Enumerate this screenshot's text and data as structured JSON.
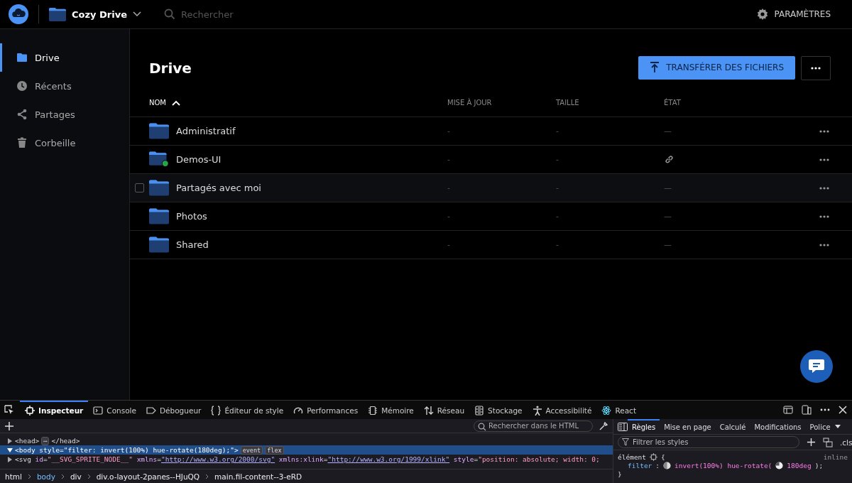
{
  "app_bar": {
    "app_name": "Cozy Drive",
    "search": {
      "placeholder": "Rechercher"
    },
    "settings": "PARAMÈTRES"
  },
  "sidebar": {
    "items": [
      {
        "label": "Drive",
        "selected": true
      },
      {
        "label": "Récents",
        "selected": false
      },
      {
        "label": "Partages",
        "selected": false
      },
      {
        "label": "Corbeille",
        "selected": false
      }
    ]
  },
  "main": {
    "title": "Drive",
    "upload_button": "TRANSFÉRER DES FICHIERS",
    "table": {
      "columns": [
        {
          "label": "NOM",
          "sorted": true
        },
        {
          "label": "MISE À JOUR",
          "sorted": false
        },
        {
          "label": "TAILLE",
          "sorted": false
        },
        {
          "label": "ÉTAT",
          "sorted": false
        }
      ],
      "rows": [
        {
          "name": "Administratif",
          "updated": "-",
          "size": "-",
          "state": {
            "kind": "none",
            "text": "—"
          },
          "shared": false,
          "hovered": false
        },
        {
          "name": "Demos-UI",
          "updated": "-",
          "size": "-",
          "state": {
            "kind": "link"
          },
          "shared": true,
          "hovered": false
        },
        {
          "name": "Partagés avec moi",
          "updated": "-",
          "size": "-",
          "state": {
            "kind": "none",
            "text": "—"
          },
          "shared": false,
          "hovered": true
        },
        {
          "name": "Photos",
          "updated": "-",
          "size": "-",
          "state": {
            "kind": "none",
            "text": "—"
          },
          "shared": false,
          "hovered": false
        },
        {
          "name": "Shared",
          "updated": "-",
          "size": "-",
          "state": {
            "kind": "none",
            "text": "—"
          },
          "shared": false,
          "hovered": false
        }
      ]
    }
  },
  "devtools": {
    "tabs": [
      {
        "label": "Inspecteur",
        "selected": true
      },
      {
        "label": "Console",
        "selected": false
      },
      {
        "label": "Débogueur",
        "selected": false
      },
      {
        "label": "Éditeur de style",
        "selected": false
      },
      {
        "label": "Performances",
        "selected": false
      },
      {
        "label": "Mémoire",
        "selected": false
      },
      {
        "label": "Réseau",
        "selected": false
      },
      {
        "label": "Stockage",
        "selected": false
      },
      {
        "label": "Accessibilité",
        "selected": false
      },
      {
        "label": "React",
        "selected": false
      }
    ],
    "html_search": {
      "placeholder": "Rechercher dans le HTML"
    },
    "markup": [
      {
        "expanded": false,
        "selected": false,
        "tokens": [
          {
            "kind": "tag",
            "text": "<head>"
          },
          {
            "kind": "badge",
            "text": "⋯"
          },
          {
            "kind": "tag",
            "text": "</head>"
          }
        ]
      },
      {
        "expanded": true,
        "selected": true,
        "tokens": [
          {
            "kind": "tag",
            "text": "<body "
          },
          {
            "kind": "attr",
            "text": "style"
          },
          {
            "kind": "tag",
            "text": "="
          },
          {
            "kind": "value",
            "text": "\"filter: invert(100%) hue-rotate(180deg);\""
          },
          {
            "kind": "tag",
            "text": ">"
          },
          {
            "kind": "badge",
            "text": "event"
          },
          {
            "kind": "badge",
            "text": "flex"
          }
        ]
      },
      {
        "expanded": false,
        "selected": false,
        "tokens": [
          {
            "kind": "tag",
            "text": "<svg "
          },
          {
            "kind": "attr",
            "text": "id"
          },
          {
            "kind": "tag",
            "text": "="
          },
          {
            "kind": "value",
            "text": "\"__SVG_SPRITE_NODE__\" "
          },
          {
            "kind": "attr",
            "text": "xmlns"
          },
          {
            "kind": "tag",
            "text": "="
          },
          {
            "kind": "link",
            "text": "\"http://www.w3.org/2000/svg\""
          },
          {
            "kind": "attr",
            "text": " xmlns:xlink"
          },
          {
            "kind": "tag",
            "text": "="
          },
          {
            "kind": "link",
            "text": "\"http://www.w3.org/1999/xlink\""
          },
          {
            "kind": "attr",
            "text": " style"
          },
          {
            "kind": "tag",
            "text": "="
          },
          {
            "kind": "value",
            "text": "\"position: absolute; width: 0;"
          }
        ]
      }
    ],
    "breadcrumbs": [
      {
        "label": "html",
        "selected": false
      },
      {
        "label": "body",
        "selected": true
      },
      {
        "label": "div",
        "selected": false
      },
      {
        "label": "div.o-layout-2panes--HJuQQ",
        "selected": false
      },
      {
        "label": "main.fil-content--3-eRD",
        "selected": false
      }
    ],
    "side_tabs": [
      {
        "label": "Règles",
        "selected": true
      },
      {
        "label": "Mise en page",
        "selected": false
      },
      {
        "label": "Calculé",
        "selected": false
      },
      {
        "label": "Modifications",
        "selected": false
      },
      {
        "label": "Police",
        "selected": false
      }
    ],
    "filter": {
      "placeholder": "Filtrer les styles"
    },
    "cls": ".cls",
    "rule": {
      "selector": "élément",
      "brace_open": "{",
      "source": "inline",
      "property": "filter",
      "colon": ":",
      "value_1": "invert(100%) hue-rotate(",
      "value_2": "180deg",
      "end": ");",
      "brace_close": "}"
    }
  }
}
